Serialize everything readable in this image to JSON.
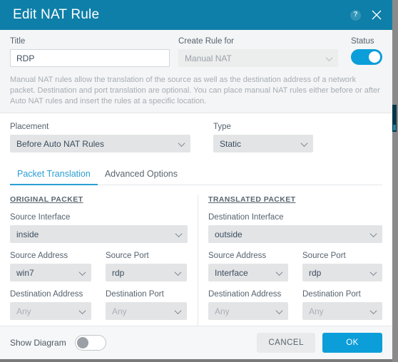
{
  "header": {
    "title": "Edit NAT Rule",
    "help_icon": "help-circle-icon",
    "help_glyph": "?",
    "close_icon": "close-icon",
    "bg_color": "#0e7fa8"
  },
  "top": {
    "title_label": "Title",
    "title_value": "RDP",
    "title_placeholder": "",
    "create_rule_label": "Create Rule for",
    "create_rule_value": "Manual NAT",
    "status_label": "Status",
    "status_on": true,
    "note": "Manual NAT rules allow the translation of the source as well as the destination address of a network packet. Destination and port translation are optional. You can place manual NAT rules either before or after Auto NAT rules and insert the rules at a specific location."
  },
  "middle": {
    "placement_label": "Placement",
    "placement_value": "Before Auto NAT Rules",
    "type_label": "Type",
    "type_value": "Static"
  },
  "tabs": [
    {
      "label": "Packet Translation",
      "active": true
    },
    {
      "label": "Advanced Options",
      "active": false
    }
  ],
  "original_packet": {
    "heading": "ORIGINAL PACKET",
    "source_interface_label": "Source Interface",
    "source_interface_value": "inside",
    "source_address_label": "Source Address",
    "source_address_value": "win7",
    "source_port_label": "Source Port",
    "source_port_value": "rdp",
    "destination_address_label": "Destination Address",
    "destination_address_value": "Any",
    "destination_port_label": "Destination Port",
    "destination_port_value": "Any"
  },
  "translated_packet": {
    "heading": "TRANSLATED PACKET",
    "destination_interface_label": "Destination Interface",
    "destination_interface_value": "outside",
    "source_address_label": "Source Address",
    "source_address_value": "Interface",
    "source_port_label": "Source Port",
    "source_port_value": "rdp",
    "destination_address_label": "Destination Address",
    "destination_address_value": "Any",
    "destination_port_label": "Destination Port",
    "destination_port_value": "Any"
  },
  "footer": {
    "show_diagram_label": "Show Diagram",
    "show_diagram_on": false,
    "cancel_label": "CANCEL",
    "ok_label": "OK",
    "ok_color": "#0c9ed9"
  }
}
